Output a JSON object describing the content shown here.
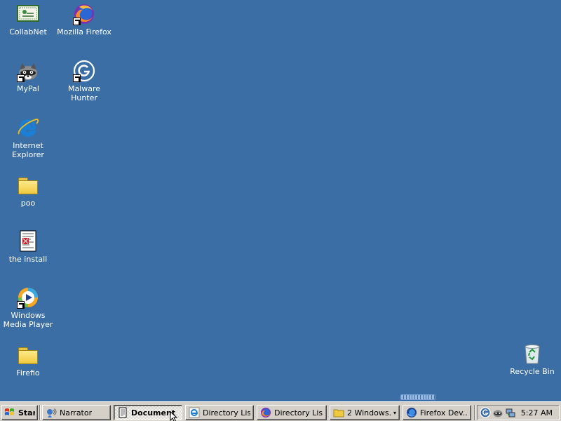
{
  "desktop": {
    "background": "#3a6ea5",
    "icons": [
      {
        "label": "CollabNet",
        "icon": "collabnet-icon"
      },
      {
        "label": "Mozilla Firefox",
        "icon": "firefox-icon"
      },
      {
        "label": "MyPal",
        "icon": "mypal-icon"
      },
      {
        "label": "Malware Hunter",
        "icon": "malware-hunter-icon"
      },
      {
        "label": "Internet Explorer",
        "icon": "internet-explorer-icon"
      },
      {
        "label": "poo",
        "icon": "folder-icon"
      },
      {
        "label": "the install",
        "icon": "document-icon"
      },
      {
        "label": "Windows Media Player",
        "icon": "windows-media-player-icon"
      },
      {
        "label": "Firefio",
        "icon": "folder-icon"
      },
      {
        "label": "Recycle Bin",
        "icon": "recycle-bin-icon"
      }
    ]
  },
  "taskbar": {
    "start_label": "Start",
    "buttons": [
      {
        "label": "Narrator",
        "icon": "narrator-icon",
        "active": false
      },
      {
        "label": "Document ...",
        "icon": "document-icon",
        "active": true
      },
      {
        "label": "Directory Lis...",
        "icon": "internet-explorer-icon",
        "active": false
      },
      {
        "label": "Directory Lis...",
        "icon": "firefox-icon",
        "active": false
      },
      {
        "label": "2  Windows...",
        "icon": "folder-icon",
        "active": false
      },
      {
        "label": "Firefox Dev...",
        "icon": "firefox-dev-icon",
        "active": false
      }
    ],
    "tray": {
      "icons": [
        "malware-hunter-tray-icon",
        "mypal-tray-icon",
        "network-tray-icon"
      ],
      "clock": "5:27 AM"
    }
  }
}
